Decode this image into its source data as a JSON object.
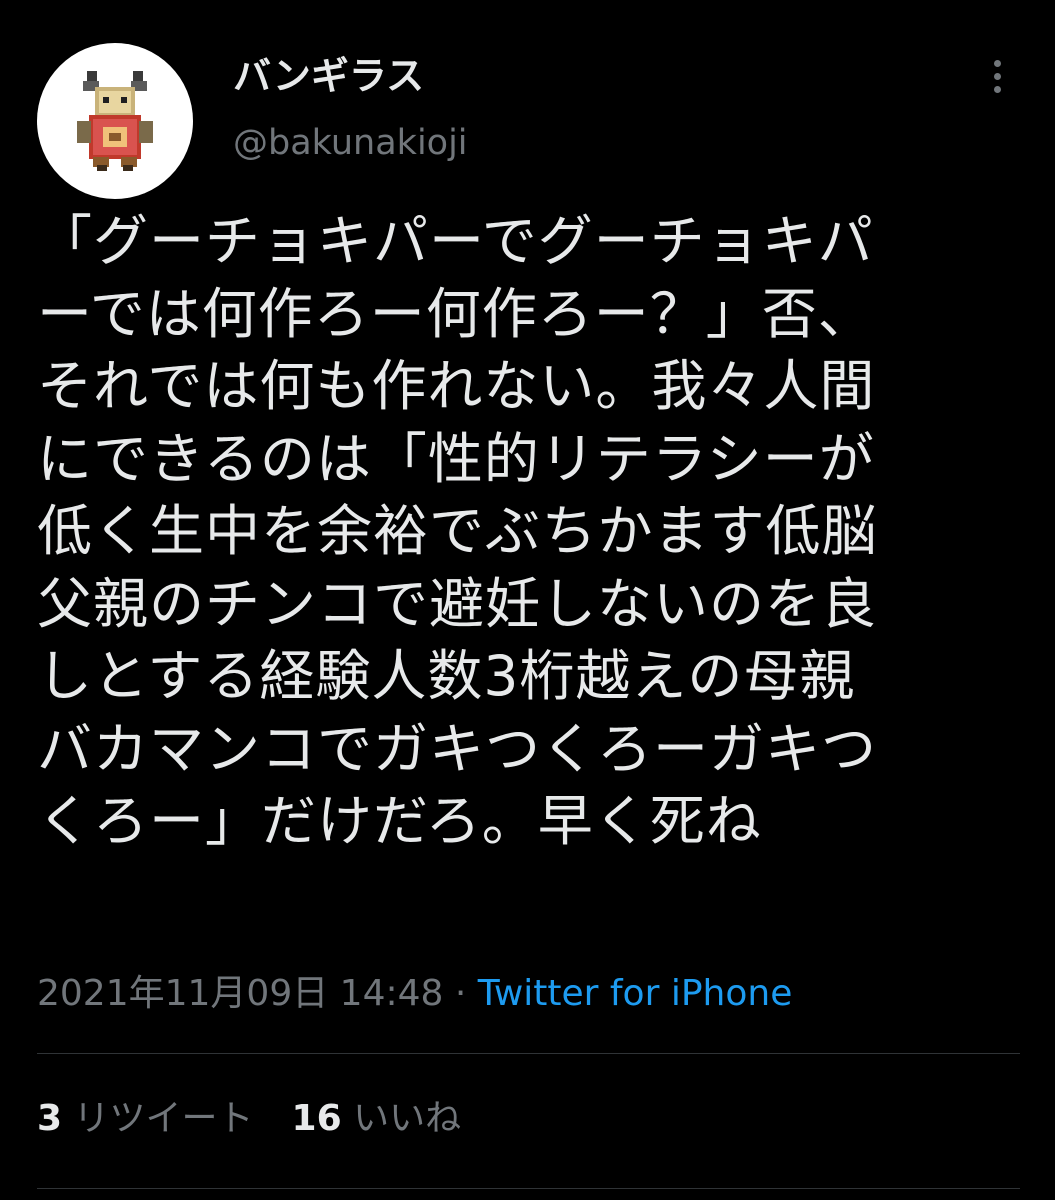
{
  "author": {
    "display_name": "バンギラス",
    "handle": "@bakunakioji",
    "avatar_icon": "pokemon-sprite-avatar"
  },
  "menu": {
    "more_icon": "more-vertical-icon"
  },
  "tweet": {
    "lines": [
      "「グーチョキパーでグーチョキパ",
      "ーでは何作ろー何作ろー？」否、",
      "それでは何も作れない。我々人間",
      "にできるのは「性的リテラシーが",
      "低く生中を余裕でぶちかます低脳",
      "父親のチンコで避妊しないのを良",
      "しとする経験人数3桁越えの母親",
      "バカマンコでガキつくろーガキつ",
      "くろー」だけだろ。早く死ね"
    ]
  },
  "meta": {
    "timestamp": "2021年11月09日 14:48",
    "separator": " · ",
    "source": "Twitter for iPhone"
  },
  "stats": {
    "retweets_count": "3",
    "retweets_label": "リツイート",
    "likes_count": "16",
    "likes_label": "いいね"
  },
  "colors": {
    "background": "#000000",
    "text": "#e7e9ea",
    "secondary": "#71767b",
    "link": "#1d9bf0",
    "divider": "#2f3336"
  }
}
